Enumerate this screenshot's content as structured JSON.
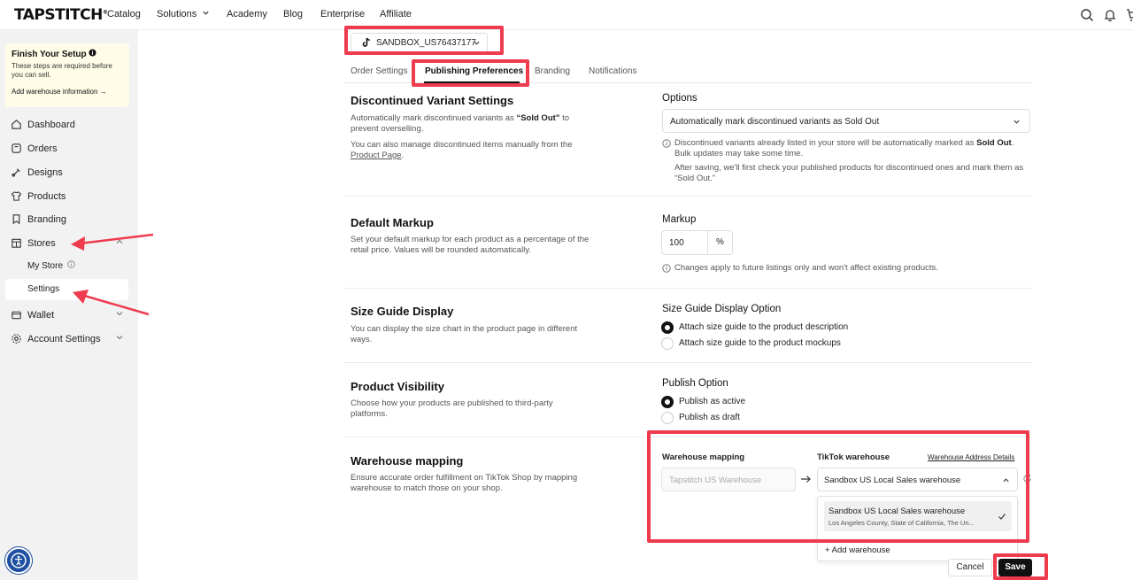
{
  "nav": {
    "logo": "TAPSTITCH",
    "links": [
      "Catalog",
      "Solutions",
      "Academy",
      "Blog",
      "Enterprise",
      "Affiliate"
    ]
  },
  "sidebar": {
    "setup": {
      "title": "Finish Your Setup",
      "desc": "These steps are required before you can sell.",
      "link": "Add warehouse information"
    },
    "items": [
      "Dashboard",
      "Orders",
      "Designs",
      "Products",
      "Branding",
      "Stores"
    ],
    "store_sub": [
      "My Store",
      "Settings"
    ],
    "items_after": [
      "Wallet",
      "Account Settings"
    ]
  },
  "store_select": "SANDBOX_US76437177",
  "tabs": [
    "Order Settings",
    "Publishing Preferences",
    "Branding",
    "Notifications"
  ],
  "sections": {
    "discontinued": {
      "title": "Discontinued Variant Settings",
      "desc_a": "Automatically mark discontinued variants as ",
      "desc_b": "“Sold Out”",
      "desc_c": " to prevent overselling.",
      "desc2_a": "You can also manage discontinued items manually from the ",
      "desc2_link": "Product Page",
      "desc2_b": ".",
      "options_label": "Options",
      "select_value": "Automatically mark discontinued variants as Sold Out",
      "note1_a": "Discontinued variants already listed in your store will be automatically marked as ",
      "note1_b": "Sold Out",
      "note1_c": ". Bulk updates may take some time.",
      "note2": "After saving, we'll first check your published products for discontinued ones and mark them as “Sold Out.”"
    },
    "markup": {
      "title": "Default Markup",
      "desc": "Set your default markup for each product as a percentage of the retail price. Values will be rounded automatically.",
      "label": "Markup",
      "value": "100",
      "unit": "%",
      "note": "Changes apply to future listings only and won't affect existing products."
    },
    "size_guide": {
      "title": "Size Guide Display",
      "desc": "You can display the size chart in the product page in different ways.",
      "label": "Size Guide Display Option",
      "options": [
        "Attach size guide to the product description",
        "Attach size guide to the product mockups"
      ]
    },
    "visibility": {
      "title": "Product Visibility",
      "desc": "Choose how your products are published to third-party platforms.",
      "label": "Publish Option",
      "options": [
        "Publish as active",
        "Publish as draft"
      ]
    },
    "warehouse": {
      "title": "Warehouse mapping",
      "desc": "Ensure accurate order fulfillment on TikTok Shop by mapping warehouse to match those on your shop.",
      "left_label": "Warehouse mapping",
      "left_value": "Tapstitch US Warehouse",
      "right_label": "TikTok warehouse",
      "details_link": "Warehouse Address Details",
      "select_value": "Sandbox US Local Sales warehouse",
      "dropdown_name": "Sandbox US Local Sales warehouse",
      "dropdown_addr": "Los Angeles County, State of California, The Un...",
      "add_label": "+ Add warehouse"
    }
  },
  "buttons": {
    "cancel": "Cancel",
    "save": "Save"
  },
  "colors": {
    "highlight": "#ef3b4e",
    "accent": "#111111",
    "sidebar_bg": "#f2f2f2",
    "setup_bg": "#fffde8"
  }
}
